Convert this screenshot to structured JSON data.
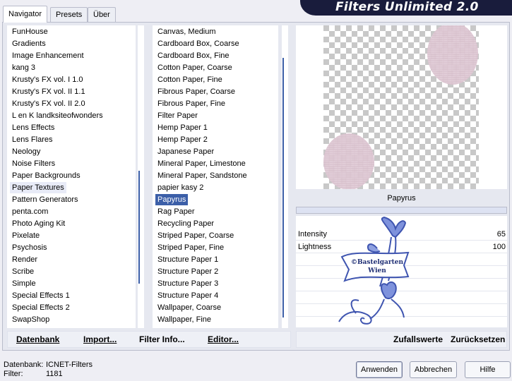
{
  "banner": "Filters Unlimited 2.0",
  "tabs": [
    "Navigator",
    "Presets",
    "Über"
  ],
  "categories": [
    "FunHouse",
    "Gradients",
    "Image Enhancement",
    "kang 3",
    "Krusty's FX vol. I 1.0",
    "Krusty's FX vol. II 1.1",
    "Krusty's FX vol. II 2.0",
    "L en K landksiteofwonders",
    "Lens Effects",
    "Lens Flares",
    "Neology",
    "Noise Filters",
    "Paper Backgrounds",
    "Paper Textures",
    "Pattern Generators",
    "penta.com",
    "Photo Aging Kit",
    "Pixelate",
    "Psychosis",
    "Render",
    "Scribe",
    "Simple",
    "Special Effects 1",
    "Special Effects 2",
    "SwapShop"
  ],
  "selected_category": "Paper Textures",
  "filters": [
    "Canvas, Medium",
    "Cardboard Box, Coarse",
    "Cardboard Box, Fine",
    "Cotton Paper, Coarse",
    "Cotton Paper, Fine",
    "Fibrous Paper, Coarse",
    "Fibrous Paper, Fine",
    "Filter Paper",
    "Hemp Paper 1",
    "Hemp Paper 2",
    "Japanese Paper",
    "Mineral Paper, Limestone",
    "Mineral Paper, Sandstone",
    "papier kasy 2",
    "Papyrus",
    "Rag Paper",
    "Recycling Paper",
    "Striped Paper, Coarse",
    "Striped Paper, Fine",
    "Structure Paper 1",
    "Structure Paper 2",
    "Structure Paper 3",
    "Structure Paper 4",
    "Wallpaper, Coarse",
    "Wallpaper, Fine"
  ],
  "selected_filter": "Papyrus",
  "toolbar": {
    "datenbank": "Datenbank",
    "import": "Import...",
    "filter_info": "Filter Info...",
    "editor": "Editor..."
  },
  "filter_name": "Papyrus",
  "parameters": [
    {
      "label": "Intensity",
      "value": "65"
    },
    {
      "label": "Lightness",
      "value": "100"
    }
  ],
  "watermark": {
    "line1": "©Bastelgarten",
    "line2": "Wien"
  },
  "settings_buttons": {
    "random": "Zufallswerte",
    "reset": "Zurücksetzen"
  },
  "status": {
    "db_label": "Datenbank:",
    "db_value": "ICNET-Filters",
    "filter_label": "Filter:",
    "filter_value": "1181"
  },
  "buttons": {
    "apply": "Anwenden",
    "cancel": "Abbrechen",
    "help": "Hilfe"
  },
  "colors": {
    "accent": "#3c5fa8",
    "banner": "#191c3c",
    "watermark": "#3f55b0"
  },
  "icons": [
    "tulip-watermark-icon"
  ]
}
